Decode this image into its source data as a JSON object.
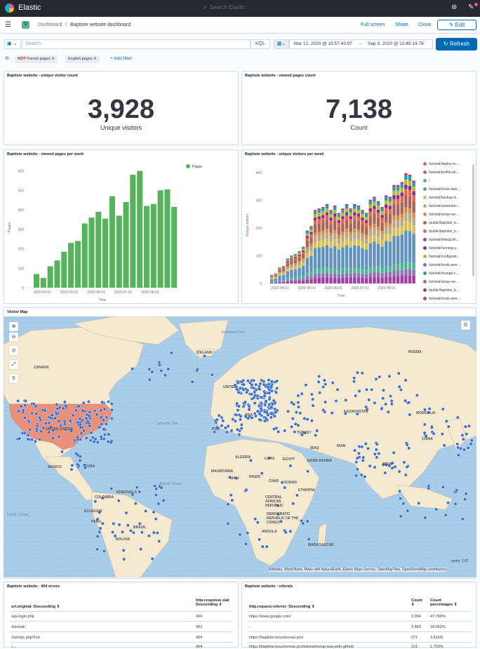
{
  "topbar": {
    "brand": "Elastic",
    "search_placeholder": "Search Elastic"
  },
  "breadcrumbs": {
    "app_badge": "D",
    "root": "Dashboard",
    "separator": "/",
    "current": "Baptiste website dashboard"
  },
  "actions": {
    "full_screen": "Full screen",
    "share": "Share",
    "clone": "Clone",
    "edit": "Edit"
  },
  "query": {
    "placeholder": "Search",
    "language": "KQL",
    "date_start": "Mar 12, 2020 @ 15:57:43.97",
    "arrow": "→",
    "date_end": "Sep 8, 2020 @ 22:45:14.78",
    "refresh": "Refresh"
  },
  "filters": [
    {
      "negate": "NOT",
      "label": "French pages"
    },
    {
      "negate": "",
      "label": "English pages"
    }
  ],
  "add_filter": "+ Add filter",
  "panels": {
    "unique_visitors": {
      "title": "Baptiste website - unique visitor count",
      "value": "3,928",
      "label": "Unique visitors"
    },
    "viewed_pages": {
      "title": "Baptiste website - viewed pages count",
      "value": "7,138",
      "label": "Count"
    },
    "pages_per_week": {
      "title": "Baptiste website - viewed pages per week"
    },
    "visitors_per_week": {
      "title": "Baptiste website - unique visitors per week"
    },
    "map": {
      "title": "Visitor Map",
      "attribution": "Wikidata, World Bank, Made with NaturalEarth, Elastic Maps Service, OpenMapTiles, OpenStreetMap contributors",
      "zoom": "zoom: 1.87"
    },
    "errors": {
      "title": "Baptiste website - 404 errors"
    },
    "referrals": {
      "title": "Baptiste website - referals"
    }
  },
  "map_labels": [
    "CANADA",
    "UNITED STATES",
    "MEXICO",
    "CUBA",
    "COLOMBIA",
    "VENEZUELA",
    "ECUADOR",
    "PERU",
    "BRAZIL",
    "BOLIVIA",
    "ICELAND",
    "RUSSIA",
    "KAZAKHSTAN",
    "MONGOLIA",
    "CHINA",
    "IRAN",
    "IRAQ",
    "TURKEY",
    "ALGERIA",
    "LIBYA",
    "EGYPT",
    "NIGER",
    "CHAD",
    "SUDAN",
    "MAURITANIA",
    "MALI",
    "ETHIOPIA",
    "SAUDI ARABIA",
    "CENTRAL AFRICAN REPUBLIC",
    "DEMOCRATIC REPUBLIC OF THE CONGO",
    "ANGOLA",
    "MADAGASCAR",
    "POR",
    "UNITED",
    "FRA",
    "INDIA"
  ],
  "map_ocean_labels": [
    "Atlantic Ocean",
    "Pacific Ocean",
    "Labrador Sea",
    "Greenland Sea"
  ],
  "chart_data": [
    {
      "type": "bar",
      "title": "Baptiste website - viewed pages per week",
      "xlabel": "Time",
      "ylabel": "Pages",
      "ylim": [
        0,
        620
      ],
      "y_ticks": [
        0,
        100,
        200,
        300,
        400,
        500,
        600
      ],
      "x_tick_labels": [
        "2020-04-01",
        "2020-05-01",
        "2020-06-01",
        "2020-07-01",
        "2020-08-01"
      ],
      "series": [
        {
          "name": "Pages",
          "color": "#54b35b",
          "values": [
            70,
            50,
            110,
            140,
            185,
            230,
            240,
            330,
            360,
            390,
            355,
            470,
            370,
            440,
            580,
            600,
            420,
            430,
            500,
            505,
            415
          ]
        }
      ]
    },
    {
      "type": "bar",
      "title": "Baptiste website - unique visitors per week",
      "xlabel": "Time",
      "ylabel": "Unique visitors",
      "ylim": [
        0,
        420
      ],
      "y_ticks": [
        0,
        100,
        200,
        300,
        400
      ],
      "x_tick_labels": [
        "2020-04-01",
        "2020-05-01",
        "2020-06-01",
        "2020-07-01",
        "2020-08-01"
      ],
      "stacked_totals": [
        30,
        35,
        55,
        60,
        85,
        95,
        100,
        110,
        125,
        180,
        195,
        250,
        255,
        260,
        270,
        250,
        265,
        240,
        255,
        270,
        255,
        270,
        265,
        250,
        240,
        285,
        295,
        280,
        260,
        300,
        295,
        335,
        335,
        345,
        375,
        370,
        350
      ],
      "legend": [
        "/tutorial/deploy-to-...",
        "/tutorial/profile-ph...",
        "/",
        "/tutorial/mock-aws-...",
        "/tutorial/backup-d...",
        "/tutorial/automatic-...",
        "/tutorial/setup-sw-...",
        "/public/baptiste_b...",
        "/public/baptiste_b...",
        "/tutorial/debug-ph...",
        "/tutorial/running-y...",
        "/tutorial/configurat...",
        "/tutorial/mock-aws-...",
        "/tutorial/change-t-...",
        "/tutorial/setup-sw-...",
        "/public/baptiste_b...",
        "/tutorial/mock-aws-..."
      ],
      "colors": [
        "#d36086",
        "#9170b8",
        "#54b399",
        "#6092c0",
        "#d6bf57",
        "#b9a888",
        "#da8b45",
        "#aa6556",
        "#e7664c",
        "#a240a2",
        "#7b3294",
        "#c3b32b",
        "#4a7fc6",
        "#19a2b8",
        "#b05f9c",
        "#8f4e3f",
        "#c83b6a"
      ]
    }
  ],
  "errors_table": {
    "col1": "url.original: Descending",
    "col2_line1": "http.response.stat",
    "col2_line2": "Descending",
    "rows": [
      [
        "/wp-login.php",
        "404"
      ],
      [
        "/tutorial/",
        "403"
      ],
      [
        "//xmlrpc.php?rsd",
        "404"
      ],
      [
        "/...",
        "404"
      ]
    ]
  },
  "referrals_table": {
    "col1": "http.request.referrer: Descending",
    "col2": "Count",
    "col3_line1": "Count",
    "col3_line2": "percentages",
    "rows": [
      [
        "https://www.google.com/",
        "3,394",
        "47.789%"
      ],
      [
        "-",
        "2,483",
        "34.962%"
      ],
      [
        "https://baptiste.bouchereau.pro/",
        "271",
        "3.816%"
      ],
      [
        "https://baptiste.bouchereau.pro/tutorial/setup-aws-with-github",
        "121",
        "1.703%"
      ]
    ]
  }
}
